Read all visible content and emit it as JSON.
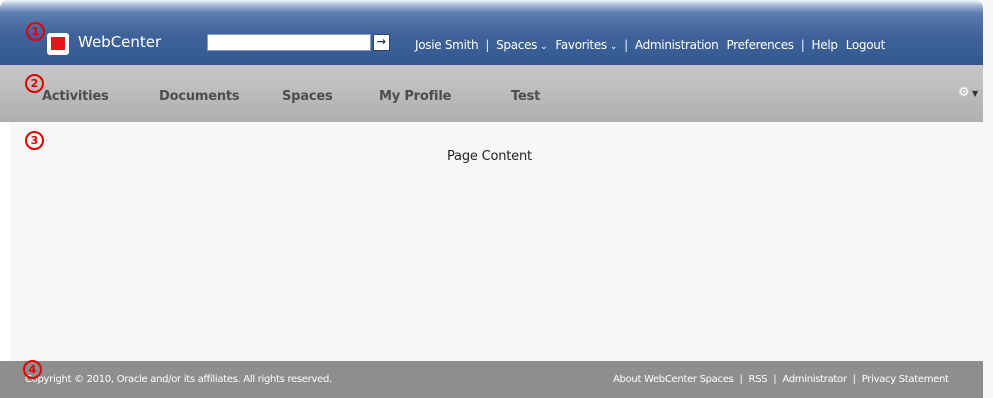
{
  "header": {
    "app_title": "WebCenter",
    "search_placeholder": "",
    "search_go_label": "→",
    "user_name": "Josie Smith",
    "spaces_label": "Spaces",
    "favorites_label": "Favorites",
    "administration_label": "Administration",
    "preferences_label": "Preferences",
    "help_label": "Help",
    "logout_label": "Logout",
    "separator": "|",
    "chevron": "⌄"
  },
  "tabs": [
    {
      "label": "Activities"
    },
    {
      "label": "Documents"
    },
    {
      "label": "Spaces"
    },
    {
      "label": "My Profile"
    },
    {
      "label": "Test"
    }
  ],
  "tabbar": {
    "gear_icon": "⚙",
    "caret": "▼"
  },
  "content": {
    "text": "Page Content"
  },
  "footer": {
    "copyright": "Copyright © 2010, Oracle and/or its affiliates. All rights reserved.",
    "links": [
      "About WebCenter Spaces",
      "RSS",
      "Administrator",
      "Privacy Statement"
    ],
    "separator": "|"
  },
  "markers": [
    "1",
    "2",
    "3",
    "4"
  ],
  "colors": {
    "header_blue": "#3f6399",
    "logo_red": "#e8141d",
    "tabbar_gray": "#bdbdbd",
    "footer_gray": "#8e8e8e",
    "marker_red": "#e00000"
  }
}
